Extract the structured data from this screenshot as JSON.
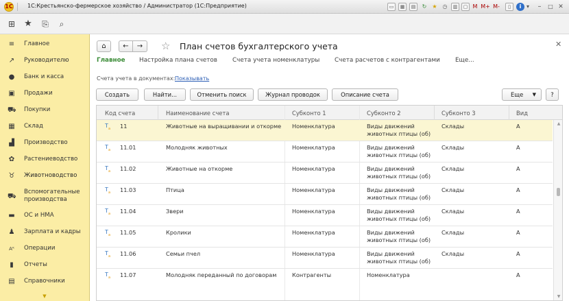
{
  "titlebar": {
    "title": "1С:Крестьянско-фермерское хозяйство / Администратор  (1С:Предприятие)",
    "icons": [
      "window-icon",
      "calculator-icon",
      "calendar-icon",
      "refresh-icon",
      "star-icon",
      "clock-icon",
      "print-icon",
      "document-icon"
    ],
    "mem_buttons": {
      "m": "M",
      "mplus": "M+",
      "mminus": "M-"
    },
    "help_label": "i"
  },
  "toolbar": {
    "icons": [
      "apps-grid-icon",
      "favorites-star-icon",
      "history-icon",
      "search-icon"
    ]
  },
  "sidebar": {
    "items": [
      {
        "label": "Главное",
        "icon": "menu-lines-icon"
      },
      {
        "label": "Руководителю",
        "icon": "chart-trend-icon"
      },
      {
        "label": "Банк и касса",
        "icon": "bank-coin-icon"
      },
      {
        "label": "Продажи",
        "icon": "sales-bag-icon"
      },
      {
        "label": "Покупки",
        "icon": "cart-icon"
      },
      {
        "label": "Склад",
        "icon": "warehouse-icon"
      },
      {
        "label": "Производство",
        "icon": "factory-icon"
      },
      {
        "label": "Растениеводство",
        "icon": "plant-icon"
      },
      {
        "label": "Животноводство",
        "icon": "animal-icon"
      },
      {
        "label": "Вспомогательные",
        "label2": "производства",
        "icon": "tractor-icon"
      },
      {
        "label": "ОС и НМА",
        "icon": "truck-icon"
      },
      {
        "label": "Зарплата и кадры",
        "icon": "person-icon"
      },
      {
        "label": "Операции",
        "icon": "operations-icon"
      },
      {
        "label": "Отчеты",
        "icon": "reports-icon"
      },
      {
        "label": "Справочники",
        "icon": "books-icon"
      }
    ]
  },
  "main": {
    "title": "План счетов бухгалтерского учета",
    "tabs": [
      "Главное",
      "Настройка плана счетов",
      "Счета учета номенклатуры",
      "Счета расчетов с контрагентами",
      "Еще..."
    ],
    "docs_label": "Счета учета в документах:",
    "docs_link": "Показывать",
    "buttons": {
      "create": "Создать",
      "find": "Найти...",
      "cancel_search": "Отменить поиск",
      "journal": "Журнал проводок",
      "description": "Описание счета",
      "more": "Еще",
      "help": "?"
    },
    "table": {
      "columns": [
        "Код счета",
        "Наименование счета",
        "Субконто 1",
        "Субконто 2",
        "Субконто 3",
        "Вид"
      ],
      "rows": [
        {
          "code": "11",
          "name": "Животные на выращивании и откорме",
          "s1": "Номенклатура",
          "s2a": "Виды движений",
          "s2b": "животных птицы (об)",
          "s3": "Склады",
          "kind": "А"
        },
        {
          "code": "11.01",
          "name": "Молодняк животных",
          "s1": "Номенклатура",
          "s2a": "Виды движений",
          "s2b": "животных птицы (об)",
          "s3": "Склады",
          "kind": "А"
        },
        {
          "code": "11.02",
          "name": "Животные на откорме",
          "s1": "Номенклатура",
          "s2a": "Виды движений",
          "s2b": "животных птицы (об)",
          "s3": "Склады",
          "kind": "А"
        },
        {
          "code": "11.03",
          "name": "Птица",
          "s1": "Номенклатура",
          "s2a": "Виды движений",
          "s2b": "животных птицы (об)",
          "s3": "Склады",
          "kind": "А"
        },
        {
          "code": "11.04",
          "name": "Звери",
          "s1": "Номенклатура",
          "s2a": "Виды движений",
          "s2b": "животных птицы (об)",
          "s3": "Склады",
          "kind": "А"
        },
        {
          "code": "11.05",
          "name": "Кролики",
          "s1": "Номенклатура",
          "s2a": "Виды движений",
          "s2b": "животных птицы (об)",
          "s3": "Склады",
          "kind": "А"
        },
        {
          "code": "11.06",
          "name": "Семьи пчел",
          "s1": "Номенклатура",
          "s2a": "Виды движений",
          "s2b": "животных птицы (об)",
          "s3": "Склады",
          "kind": "А"
        },
        {
          "code": "11.07",
          "name": "Молодняк переданный по договорам",
          "s1": "Контрагенты",
          "s2a": "Номенклатура",
          "s2b": "",
          "s3": "",
          "kind": "А"
        }
      ]
    }
  },
  "colors": {
    "sidebar_bg": "#fbeda5",
    "active_tab": "#3a8b36",
    "link": "#2d5fb5",
    "selected_row": "#fbf6d2"
  }
}
